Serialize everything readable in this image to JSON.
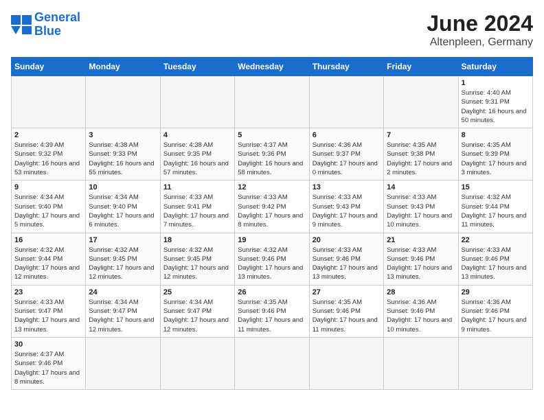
{
  "header": {
    "logo_general": "General",
    "logo_blue": "Blue",
    "title": "June 2024",
    "subtitle": "Altenpleen, Germany"
  },
  "weekdays": [
    "Sunday",
    "Monday",
    "Tuesday",
    "Wednesday",
    "Thursday",
    "Friday",
    "Saturday"
  ],
  "weeks": [
    [
      {
        "day": "",
        "empty": true
      },
      {
        "day": "",
        "empty": true
      },
      {
        "day": "",
        "empty": true
      },
      {
        "day": "",
        "empty": true
      },
      {
        "day": "",
        "empty": true
      },
      {
        "day": "",
        "empty": true
      },
      {
        "day": "1",
        "sunrise": "4:40 AM",
        "sunset": "9:31 PM",
        "daylight": "16 hours and 50 minutes."
      }
    ],
    [
      {
        "day": "2",
        "sunrise": "4:39 AM",
        "sunset": "9:32 PM",
        "daylight": "16 hours and 53 minutes."
      },
      {
        "day": "3",
        "sunrise": "4:38 AM",
        "sunset": "9:33 PM",
        "daylight": "16 hours and 55 minutes."
      },
      {
        "day": "4",
        "sunrise": "4:38 AM",
        "sunset": "9:35 PM",
        "daylight": "16 hours and 57 minutes."
      },
      {
        "day": "5",
        "sunrise": "4:37 AM",
        "sunset": "9:36 PM",
        "daylight": "16 hours and 58 minutes."
      },
      {
        "day": "6",
        "sunrise": "4:36 AM",
        "sunset": "9:37 PM",
        "daylight": "17 hours and 0 minutes."
      },
      {
        "day": "7",
        "sunrise": "4:35 AM",
        "sunset": "9:38 PM",
        "daylight": "17 hours and 2 minutes."
      },
      {
        "day": "8",
        "sunrise": "4:35 AM",
        "sunset": "9:39 PM",
        "daylight": "17 hours and 3 minutes."
      }
    ],
    [
      {
        "day": "9",
        "sunrise": "4:34 AM",
        "sunset": "9:40 PM",
        "daylight": "17 hours and 5 minutes."
      },
      {
        "day": "10",
        "sunrise": "4:34 AM",
        "sunset": "9:40 PM",
        "daylight": "17 hours and 6 minutes."
      },
      {
        "day": "11",
        "sunrise": "4:33 AM",
        "sunset": "9:41 PM",
        "daylight": "17 hours and 7 minutes."
      },
      {
        "day": "12",
        "sunrise": "4:33 AM",
        "sunset": "9:42 PM",
        "daylight": "17 hours and 8 minutes."
      },
      {
        "day": "13",
        "sunrise": "4:33 AM",
        "sunset": "9:43 PM",
        "daylight": "17 hours and 9 minutes."
      },
      {
        "day": "14",
        "sunrise": "4:33 AM",
        "sunset": "9:43 PM",
        "daylight": "17 hours and 10 minutes."
      },
      {
        "day": "15",
        "sunrise": "4:32 AM",
        "sunset": "9:44 PM",
        "daylight": "17 hours and 11 minutes."
      }
    ],
    [
      {
        "day": "16",
        "sunrise": "4:32 AM",
        "sunset": "9:44 PM",
        "daylight": "17 hours and 12 minutes."
      },
      {
        "day": "17",
        "sunrise": "4:32 AM",
        "sunset": "9:45 PM",
        "daylight": "17 hours and 12 minutes."
      },
      {
        "day": "18",
        "sunrise": "4:32 AM",
        "sunset": "9:45 PM",
        "daylight": "17 hours and 12 minutes."
      },
      {
        "day": "19",
        "sunrise": "4:32 AM",
        "sunset": "9:46 PM",
        "daylight": "17 hours and 13 minutes."
      },
      {
        "day": "20",
        "sunrise": "4:33 AM",
        "sunset": "9:46 PM",
        "daylight": "17 hours and 13 minutes."
      },
      {
        "day": "21",
        "sunrise": "4:33 AM",
        "sunset": "9:46 PM",
        "daylight": "17 hours and 13 minutes."
      },
      {
        "day": "22",
        "sunrise": "4:33 AM",
        "sunset": "9:46 PM",
        "daylight": "17 hours and 13 minutes."
      }
    ],
    [
      {
        "day": "23",
        "sunrise": "4:33 AM",
        "sunset": "9:47 PM",
        "daylight": "17 hours and 13 minutes."
      },
      {
        "day": "24",
        "sunrise": "4:34 AM",
        "sunset": "9:47 PM",
        "daylight": "17 hours and 12 minutes."
      },
      {
        "day": "25",
        "sunrise": "4:34 AM",
        "sunset": "9:47 PM",
        "daylight": "17 hours and 12 minutes."
      },
      {
        "day": "26",
        "sunrise": "4:35 AM",
        "sunset": "9:46 PM",
        "daylight": "17 hours and 11 minutes."
      },
      {
        "day": "27",
        "sunrise": "4:35 AM",
        "sunset": "9:46 PM",
        "daylight": "17 hours and 11 minutes."
      },
      {
        "day": "28",
        "sunrise": "4:36 AM",
        "sunset": "9:46 PM",
        "daylight": "17 hours and 10 minutes."
      },
      {
        "day": "29",
        "sunrise": "4:36 AM",
        "sunset": "9:46 PM",
        "daylight": "17 hours and 9 minutes."
      }
    ],
    [
      {
        "day": "30",
        "sunrise": "4:37 AM",
        "sunset": "9:46 PM",
        "daylight": "17 hours and 8 minutes."
      },
      {
        "day": "",
        "empty": true
      },
      {
        "day": "",
        "empty": true
      },
      {
        "day": "",
        "empty": true
      },
      {
        "day": "",
        "empty": true
      },
      {
        "day": "",
        "empty": true
      },
      {
        "day": "",
        "empty": true
      }
    ]
  ],
  "labels": {
    "sunrise": "Sunrise:",
    "sunset": "Sunset:",
    "daylight": "Daylight:"
  }
}
